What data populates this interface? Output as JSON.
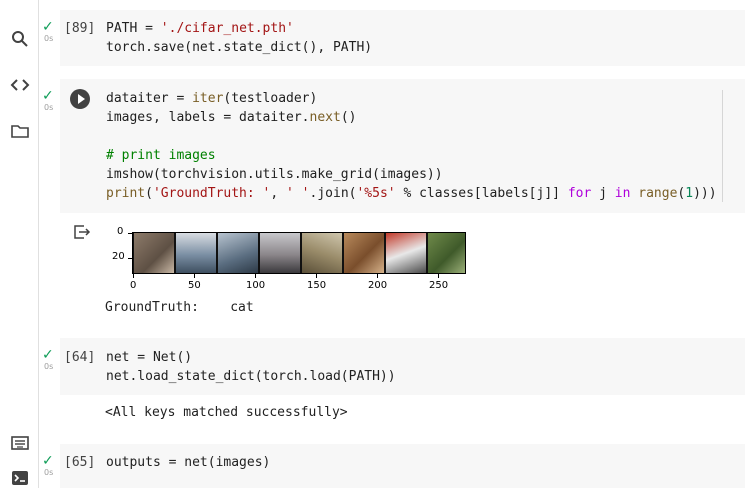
{
  "cells": {
    "c89": {
      "prompt": "[89]",
      "status": "0s",
      "lines": [
        "PATH = './cifar_net.pth'",
        "torch.save(net.state_dict(), PATH)"
      ]
    },
    "c_run": {
      "status": "0s",
      "lines": [
        "dataiter = iter(testloader)",
        "images, labels = dataiter.next()",
        "",
        "# print images",
        "imshow(torchvision.utils.make_grid(images))",
        "print('GroundTruth: ', ' '.join('%5s' % classes[labels[j]] for j in range(1)))"
      ],
      "output_text": "GroundTruth:    cat"
    },
    "c64": {
      "prompt": "[64]",
      "status": "0s",
      "lines": [
        "net = Net()",
        "net.load_state_dict(torch.load(PATH))"
      ],
      "output_text": "<All keys matched successfully>"
    },
    "c65": {
      "prompt": "[65]",
      "status": "0s",
      "lines": [
        "outputs = net(images)"
      ]
    }
  },
  "plot": {
    "x_ticks": [
      "0",
      "50",
      "100",
      "150",
      "200",
      "250"
    ],
    "y_ticks": [
      "0",
      "20"
    ]
  },
  "sidebar": {
    "icons": [
      "search-icon",
      "code-snippets-icon",
      "folder-icon",
      "command-palette-icon",
      "terminal-icon"
    ]
  }
}
